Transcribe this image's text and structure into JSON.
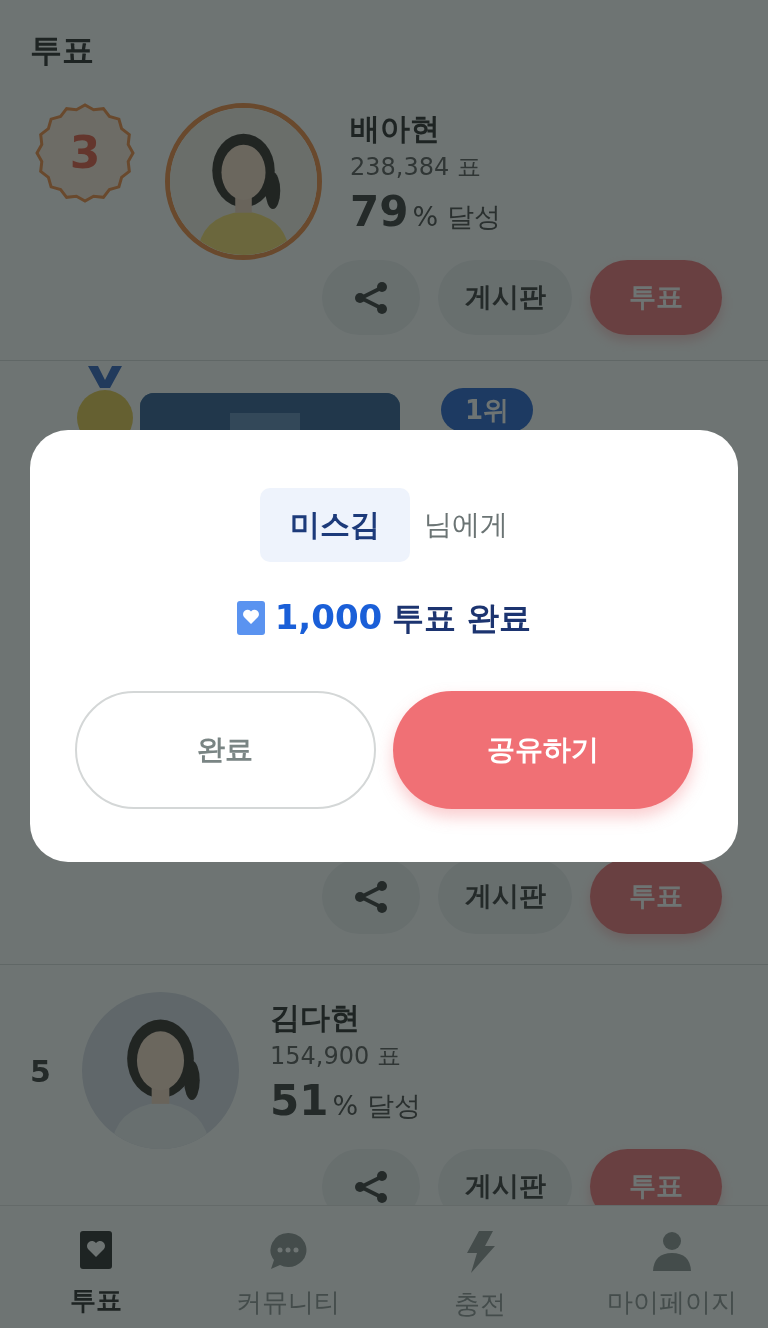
{
  "header": {
    "title": "투표"
  },
  "entries": [
    {
      "kind": "badge",
      "rank": "3",
      "name": "배아현",
      "votes": "238,384 표",
      "percent": "79",
      "percent_label": "% 달성",
      "actions": {
        "board": "게시판",
        "vote": "투표"
      }
    },
    {
      "kind": "medal",
      "rank_tag": "1위",
      "actions": {
        "board": "게시판",
        "vote": "투표"
      }
    },
    {
      "kind": "plain",
      "rank": "5",
      "name": "김다현",
      "votes": "154,900 표",
      "percent": "51",
      "percent_label": "% 달성",
      "actions": {
        "board": "게시판",
        "vote": "투표"
      }
    }
  ],
  "modal": {
    "recipient": "미스김",
    "recipient_suffix": "님에게",
    "amount": "1,000",
    "result": "투표 완료",
    "buttons": [
      {
        "label": "완료",
        "kind": "secondary"
      },
      {
        "label": "공유하기",
        "kind": "primary"
      }
    ]
  },
  "nav": [
    {
      "label": "투표",
      "selected": true
    },
    {
      "label": "커뮤니티",
      "selected": false
    },
    {
      "label": "충전",
      "selected": false
    },
    {
      "label": "마이페이지",
      "selected": false
    }
  ]
}
